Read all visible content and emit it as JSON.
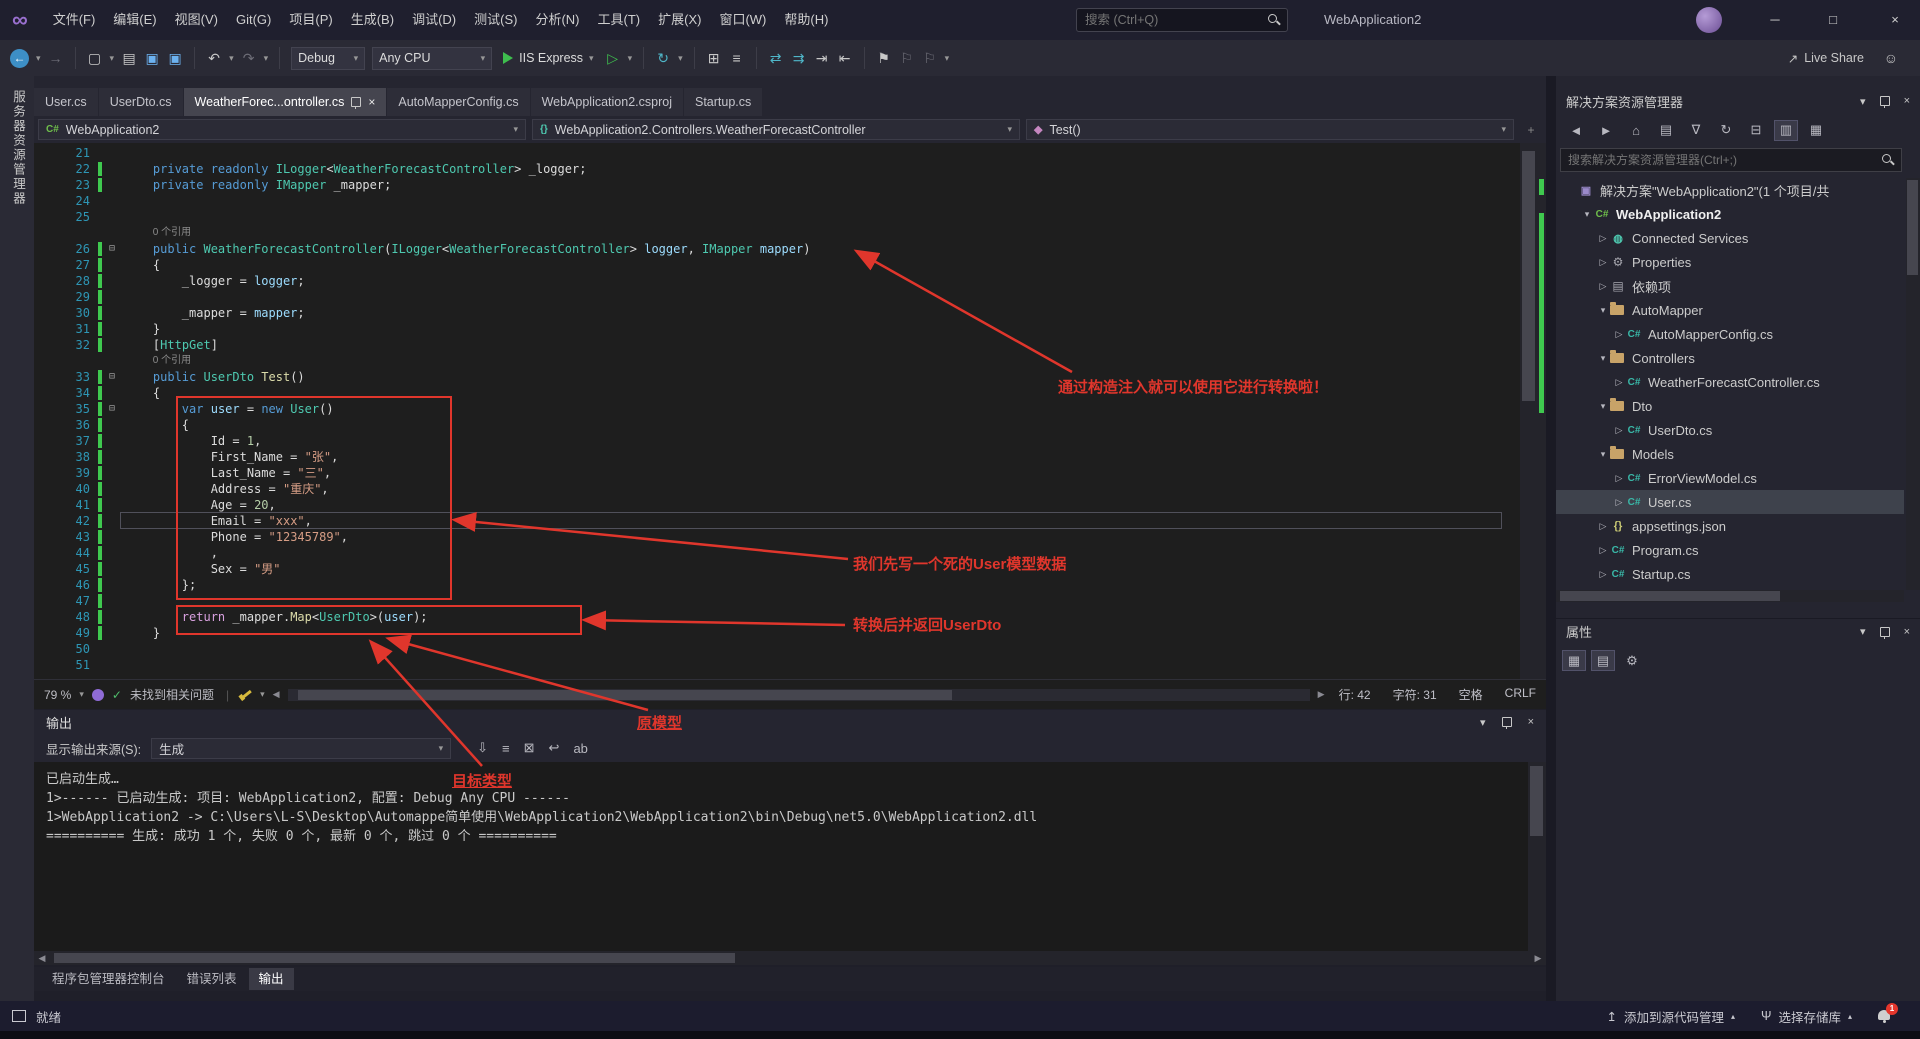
{
  "icons": {
    "chevron": "▾",
    "chevron_up": "▴",
    "close": "×",
    "minimize": "─",
    "maximize": "□",
    "back": "←",
    "forward": "→",
    "undo": "↶",
    "redo": "↷",
    "refresh": "↻",
    "flag": "⚑",
    "flag_outline": "⚐",
    "home": "⌂",
    "check": "✓",
    "gear": "⚙",
    "arrow_open": "▾",
    "arrow_closed": "▷",
    "cs_badge": "C#",
    "braces": "{}",
    "cube": "◆",
    "left_small": "◀",
    "right_small": "▶",
    "infinity": "∞",
    "person": "☺",
    "fold": "⊟",
    "solution": "▣",
    "services": "◍",
    "wrench": "⚙",
    "deps": "▤",
    "publish": "↥",
    "branch": "Ψ",
    "live_share": "↗"
  },
  "title_bar": {
    "menus": [
      "文件(F)",
      "编辑(E)",
      "视图(V)",
      "Git(G)",
      "项目(P)",
      "生成(B)",
      "调试(D)",
      "测试(S)",
      "分析(N)",
      "工具(T)",
      "扩展(X)",
      "窗口(W)",
      "帮助(H)"
    ],
    "search_placeholder": "搜索 (Ctrl+Q)",
    "app_title": "WebApplication2"
  },
  "toolbar": {
    "live_share_label": "Live Share",
    "items": [
      {
        "k": "icon",
        "name": "navigate-back-icon",
        "glyph": "←",
        "cls": "circ"
      },
      {
        "k": "chev",
        "name": "navigate-back-dropdown"
      },
      {
        "k": "icon",
        "name": "navigate-forward-icon",
        "glyph": "→",
        "cls": "dim"
      },
      {
        "k": "sep"
      },
      {
        "k": "icon",
        "name": "new-project-icon",
        "glyph": "▢"
      },
      {
        "k": "chev",
        "name": "new-project-dropdown"
      },
      {
        "k": "icon",
        "name": "open-file-icon",
        "glyph": "▤"
      },
      {
        "k": "icon",
        "name": "save-icon",
        "glyph": "▣",
        "cls": "blue"
      },
      {
        "k": "icon",
        "name": "save-all-icon",
        "glyph": "▣",
        "cls": "blue"
      },
      {
        "k": "sep"
      },
      {
        "k": "icon",
        "name": "undo-icon",
        "glyph": "↶"
      },
      {
        "k": "chev",
        "name": "undo-dropdown"
      },
      {
        "k": "icon",
        "name": "redo-icon",
        "glyph": "↷",
        "cls": "dim"
      },
      {
        "k": "chev",
        "name": "redo-dropdown"
      },
      {
        "k": "sep"
      },
      {
        "k": "combo",
        "name": "solution-configuration-combo",
        "label": "Debug",
        "w": 74
      },
      {
        "k": "combo",
        "name": "solution-platform-combo",
        "label": "Any CPU",
        "w": 120
      },
      {
        "k": "run",
        "name": "start-debugging-button",
        "label": "IIS Express"
      },
      {
        "k": "icon",
        "name": "start-without-debugging-icon",
        "glyph": "▷",
        "cls": "green"
      },
      {
        "k": "chev",
        "name": "run-target-dropdown"
      },
      {
        "k": "sep"
      },
      {
        "k": "icon",
        "name": "hot-reload-icon",
        "glyph": "↻",
        "cls": "teal"
      },
      {
        "k": "chev",
        "name": "hot-reload-dropdown"
      },
      {
        "k": "sep"
      },
      {
        "k": "icon",
        "name": "find-in-files-icon",
        "glyph": "⊞"
      },
      {
        "k": "icon",
        "name": "line-operations-icon",
        "glyph": "≡"
      },
      {
        "k": "sep"
      },
      {
        "k": "icon",
        "name": "show-directives-icon",
        "glyph": "⇄",
        "cls": "teal"
      },
      {
        "k": "icon",
        "name": "display-lines-icon",
        "glyph": "⇉",
        "cls": "teal"
      },
      {
        "k": "icon",
        "name": "indent-icon",
        "glyph": "⇥"
      },
      {
        "k": "icon",
        "name": "outdent-icon",
        "glyph": "⇤"
      },
      {
        "k": "sep"
      },
      {
        "k": "icon",
        "name": "bookmark-icon",
        "glyph": "⚑"
      },
      {
        "k": "icon",
        "name": "prev-bookmark-icon",
        "glyph": "⚐",
        "cls": "dim"
      },
      {
        "k": "icon",
        "name": "next-bookmark-icon",
        "glyph": "⚐",
        "cls": "dim"
      },
      {
        "k": "chev",
        "name": "bookmark-dropdown"
      }
    ]
  },
  "left_strip": {
    "label": "服务器资源管理器"
  },
  "tabs": [
    {
      "label": "User.cs",
      "active": false
    },
    {
      "label": "UserDto.cs",
      "active": false
    },
    {
      "label": "WeatherForec...ontroller.cs",
      "active": true
    },
    {
      "label": "AutoMapperConfig.cs",
      "active": false
    },
    {
      "label": "WebApplication2.csproj",
      "active": false
    },
    {
      "label": "Startup.cs",
      "active": false
    }
  ],
  "navbar": {
    "project": "WebApplication2",
    "type_name": "WebApplication2.Controllers.WeatherForecastController",
    "member": "Test()"
  },
  "editor": {
    "codelens_label": "0 个引用",
    "rows": [
      {
        "n": "21"
      },
      {
        "n": "22",
        "ind": 4,
        "g": 1,
        "tk": [
          {
            "t": "private readonly ",
            "c": "kw"
          },
          {
            "t": "ILogger",
            "c": "ty"
          },
          {
            "t": "<",
            "c": "pu"
          },
          {
            "t": "WeatherForecastController",
            "c": "ty"
          },
          {
            "t": "> ",
            "c": "pu"
          },
          {
            "t": "_logger",
            "c": "fd"
          },
          {
            "t": ";",
            "c": "pu"
          }
        ]
      },
      {
        "n": "23",
        "ind": 4,
        "g": 1,
        "tk": [
          {
            "t": "private readonly ",
            "c": "kw"
          },
          {
            "t": "IMapper",
            "c": "ty"
          },
          {
            "t": " _mapper",
            "c": "fd"
          },
          {
            "t": ";",
            "c": "pu"
          }
        ]
      },
      {
        "n": "24"
      },
      {
        "n": "25"
      },
      {
        "cl": true,
        "ind": 4
      },
      {
        "n": "26",
        "ind": 4,
        "g": 1,
        "f": 1,
        "tk": [
          {
            "t": "public ",
            "c": "kw"
          },
          {
            "t": "WeatherForecastController",
            "c": "ty"
          },
          {
            "t": "(",
            "c": "pu"
          },
          {
            "t": "ILogger",
            "c": "ty"
          },
          {
            "t": "<",
            "c": "pu"
          },
          {
            "t": "WeatherForecastController",
            "c": "ty"
          },
          {
            "t": "> ",
            "c": "pu"
          },
          {
            "t": "logger",
            "c": "pr"
          },
          {
            "t": ", ",
            "c": "pu"
          },
          {
            "t": "IMapper",
            "c": "ty"
          },
          {
            "t": " ",
            "c": "pu"
          },
          {
            "t": "mapper",
            "c": "pr"
          },
          {
            "t": ")",
            "c": "pu"
          }
        ]
      },
      {
        "n": "27",
        "ind": 4,
        "g": 1,
        "tk": [
          {
            "t": "{",
            "c": "pu"
          }
        ]
      },
      {
        "n": "28",
        "ind": 8,
        "g": 1,
        "tk": [
          {
            "t": "_logger",
            "c": "fd"
          },
          {
            "t": " = ",
            "c": "pu"
          },
          {
            "t": "logger",
            "c": "pr"
          },
          {
            "t": ";",
            "c": "pu"
          }
        ]
      },
      {
        "n": "29",
        "g": 1
      },
      {
        "n": "30",
        "ind": 8,
        "g": 1,
        "tk": [
          {
            "t": "_mapper",
            "c": "fd"
          },
          {
            "t": " = ",
            "c": "pu"
          },
          {
            "t": "mapper",
            "c": "pr"
          },
          {
            "t": ";",
            "c": "pu"
          }
        ]
      },
      {
        "n": "31",
        "ind": 4,
        "g": 1,
        "tk": [
          {
            "t": "}",
            "c": "pu"
          }
        ]
      },
      {
        "n": "32",
        "ind": 4,
        "g": 1,
        "tk": [
          {
            "t": "[",
            "c": "pu"
          },
          {
            "t": "HttpGet",
            "c": "ty"
          },
          {
            "t": "]",
            "c": "pu"
          }
        ]
      },
      {
        "cl": true,
        "ind": 4
      },
      {
        "n": "33",
        "ind": 4,
        "g": 1,
        "f": 1,
        "tk": [
          {
            "t": "public ",
            "c": "kw"
          },
          {
            "t": "UserDto",
            "c": "ty"
          },
          {
            "t": " ",
            "c": "pu"
          },
          {
            "t": "Test",
            "c": "mt"
          },
          {
            "t": "()",
            "c": "pu"
          }
        ]
      },
      {
        "n": "34",
        "ind": 4,
        "g": 1,
        "tk": [
          {
            "t": "{",
            "c": "pu"
          }
        ]
      },
      {
        "n": "35",
        "ind": 8,
        "g": 1,
        "f": 1,
        "tk": [
          {
            "t": "var",
            "c": "kw"
          },
          {
            "t": " ",
            "c": "pu"
          },
          {
            "t": "user",
            "c": "lc"
          },
          {
            "t": " = ",
            "c": "pu"
          },
          {
            "t": "new",
            "c": "kw"
          },
          {
            "t": " ",
            "c": "pu"
          },
          {
            "t": "User",
            "c": "ty"
          },
          {
            "t": "()",
            "c": "pu"
          }
        ]
      },
      {
        "n": "36",
        "ind": 8,
        "g": 1,
        "tk": [
          {
            "t": "{",
            "c": "pu"
          }
        ]
      },
      {
        "n": "37",
        "ind": 12,
        "g": 1,
        "tk": [
          {
            "t": "Id",
            "c": "pl"
          },
          {
            "t": " = ",
            "c": "pu"
          },
          {
            "t": "1",
            "c": "nm"
          },
          {
            "t": ",",
            "c": "pu"
          }
        ]
      },
      {
        "n": "38",
        "ind": 12,
        "g": 1,
        "tk": [
          {
            "t": "First_Name",
            "c": "pl"
          },
          {
            "t": " = ",
            "c": "pu"
          },
          {
            "t": "\"张\"",
            "c": "st"
          },
          {
            "t": ",",
            "c": "pu"
          }
        ]
      },
      {
        "n": "39",
        "ind": 12,
        "g": 1,
        "tk": [
          {
            "t": "Last_Name",
            "c": "pl"
          },
          {
            "t": " = ",
            "c": "pu"
          },
          {
            "t": "\"三\"",
            "c": "st"
          },
          {
            "t": ",",
            "c": "pu"
          }
        ]
      },
      {
        "n": "40",
        "ind": 12,
        "g": 1,
        "tk": [
          {
            "t": "Address",
            "c": "pl"
          },
          {
            "t": " = ",
            "c": "pu"
          },
          {
            "t": "\"重庆\"",
            "c": "st"
          },
          {
            "t": ",",
            "c": "pu"
          }
        ]
      },
      {
        "n": "41",
        "ind": 12,
        "g": 1,
        "tk": [
          {
            "t": "Age",
            "c": "pl"
          },
          {
            "t": " = ",
            "c": "pu"
          },
          {
            "t": "20",
            "c": "nm"
          },
          {
            "t": ",",
            "c": "pu"
          }
        ]
      },
      {
        "n": "42",
        "ind": 12,
        "g": 1,
        "cur": 1,
        "tk": [
          {
            "t": "Email",
            "c": "pl"
          },
          {
            "t": " = ",
            "c": "pu"
          },
          {
            "t": "\"xxx\"",
            "c": "st"
          },
          {
            "t": ",",
            "c": "pu"
          }
        ]
      },
      {
        "n": "43",
        "ind": 12,
        "g": 1,
        "tk": [
          {
            "t": "Phone",
            "c": "pl"
          },
          {
            "t": " = ",
            "c": "pu"
          },
          {
            "t": "\"12345789\"",
            "c": "st"
          },
          {
            "t": ",",
            "c": "pu"
          }
        ]
      },
      {
        "n": "44",
        "ind": 12,
        "g": 1,
        "tk": [
          {
            "t": ",",
            "c": "pu"
          }
        ]
      },
      {
        "n": "45",
        "ind": 12,
        "g": 1,
        "tk": [
          {
            "t": "Sex",
            "c": "pl"
          },
          {
            "t": " = ",
            "c": "pu"
          },
          {
            "t": "\"男\"",
            "c": "st"
          }
        ]
      },
      {
        "n": "46",
        "ind": 8,
        "g": 1,
        "tk": [
          {
            "t": "};",
            "c": "pu"
          }
        ]
      },
      {
        "n": "47",
        "g": 1
      },
      {
        "n": "48",
        "ind": 8,
        "g": 1,
        "tk": [
          {
            "t": "return",
            "c": "ct"
          },
          {
            "t": " ",
            "c": "pu"
          },
          {
            "t": "_mapper",
            "c": "fd"
          },
          {
            "t": ".",
            "c": "pu"
          },
          {
            "t": "Map",
            "c": "mt"
          },
          {
            "t": "<",
            "c": "pu"
          },
          {
            "t": "UserDto",
            "c": "ty"
          },
          {
            "t": ">(",
            "c": "pu"
          },
          {
            "t": "user",
            "c": "lc"
          },
          {
            "t": ");",
            "c": "pu"
          }
        ]
      },
      {
        "n": "49",
        "ind": 4,
        "g": 1,
        "tk": [
          {
            "t": "}",
            "c": "pu"
          }
        ]
      },
      {
        "n": "50"
      },
      {
        "n": "51"
      }
    ],
    "status": {
      "zoom": "79 %",
      "issues": "未找到相关问题",
      "line": "行: 42",
      "column": "字符: 31",
      "spaces": "空格",
      "line_ending": "CRLF"
    }
  },
  "annotations": {
    "constructor_note": "通过构造注入就可以使用它进行转换啦！",
    "model_note": "我们先写一个死的User模型数据",
    "return_note": "转换后并返回UserDto",
    "source_label": "原模型",
    "target_label": "目标类型"
  },
  "output": {
    "title": "输出",
    "source_label": "显示输出来源(S):",
    "source_value": "生成",
    "toolbar_icons": [
      {
        "name": "goto-message-icon",
        "glyph": "⇩"
      },
      {
        "name": "message-list-icon",
        "glyph": "≡"
      },
      {
        "name": "clear-all-icon",
        "glyph": "⊠"
      },
      {
        "name": "toggle-wrap-icon",
        "glyph": "↩"
      },
      {
        "name": "word-wrap-icon",
        "glyph": "ab"
      }
    ],
    "lines": [
      "已启动生成…",
      "1>------ 已启动生成: 项目: WebApplication2, 配置: Debug Any CPU ------",
      "1>WebApplication2 -> C:\\Users\\L-S\\Desktop\\Automappe简单使用\\WebApplication2\\WebApplication2\\bin\\Debug\\net5.0\\WebApplication2.dll",
      "========== 生成: 成功 1 个, 失败 0 个, 最新 0 个, 跳过 0 个 =========="
    ]
  },
  "bottom_tabs": {
    "items": [
      "程序包管理器控制台",
      "错误列表",
      "输出"
    ],
    "active_index": 2
  },
  "solution_explorer": {
    "title": "解决方案资源管理器",
    "search_placeholder": "搜索解决方案资源管理器(Ctrl+;)",
    "toolbar_icons": [
      {
        "name": "back-icon",
        "glyph": "◄"
      },
      {
        "name": "forward-icon",
        "glyph": "►"
      },
      {
        "name": "home-icon",
        "glyph": "⌂"
      },
      {
        "name": "switch-views-icon",
        "glyph": "▤"
      },
      {
        "name": "filter-icon",
        "glyph": "∇"
      },
      {
        "name": "sync-with-active-document-icon",
        "glyph": "↻"
      },
      {
        "name": "collapse-all-icon",
        "glyph": "⊟"
      },
      {
        "name": "preview-selected-icon",
        "glyph": "▥",
        "hl": true
      },
      {
        "name": "show-all-files-icon",
        "glyph": "▦"
      }
    ],
    "tree": [
      {
        "indent": 0,
        "arrow": "none",
        "icon": "solution",
        "label": "解决方案\"WebApplication2\"(1 个项目/共"
      },
      {
        "indent": 1,
        "arrow": "open",
        "icon": "csproj",
        "label": "WebApplication2",
        "bold": true
      },
      {
        "indent": 2,
        "arrow": "closed",
        "icon": "services",
        "label": "Connected Services"
      },
      {
        "indent": 2,
        "arrow": "closed",
        "icon": "properties",
        "label": "Properties"
      },
      {
        "indent": 2,
        "arrow": "closed",
        "icon": "deps",
        "label": "依赖项"
      },
      {
        "indent": 2,
        "arrow": "open",
        "icon": "folder",
        "label": "AutoMapper"
      },
      {
        "indent": 3,
        "arrow": "closed",
        "icon": "cs",
        "label": "AutoMapperConfig.cs"
      },
      {
        "indent": 2,
        "arrow": "open",
        "icon": "folder",
        "label": "Controllers"
      },
      {
        "indent": 3,
        "arrow": "closed",
        "icon": "cs",
        "label": "WeatherForecastController.cs"
      },
      {
        "indent": 2,
        "arrow": "open",
        "icon": "folder",
        "label": "Dto"
      },
      {
        "indent": 3,
        "arrow": "closed",
        "icon": "cs",
        "label": "UserDto.cs"
      },
      {
        "indent": 2,
        "arrow": "open",
        "icon": "folder",
        "label": "Models"
      },
      {
        "indent": 3,
        "arrow": "closed",
        "icon": "cs",
        "label": "ErrorViewModel.cs"
      },
      {
        "indent": 3,
        "arrow": "closed",
        "icon": "cs",
        "label": "User.cs",
        "selected": true
      },
      {
        "indent": 2,
        "arrow": "closed",
        "icon": "json",
        "label": "appsettings.json"
      },
      {
        "indent": 2,
        "arrow": "closed",
        "icon": "cs",
        "label": "Program.cs"
      },
      {
        "indent": 2,
        "arrow": "closed",
        "icon": "cs",
        "label": "Startup.cs"
      }
    ]
  },
  "properties_panel": {
    "title": "属性",
    "toolbar_icons": [
      {
        "name": "categorized-icon",
        "glyph": "▦",
        "hl": true
      },
      {
        "name": "alphabetical-icon",
        "glyph": "▤",
        "hl": true
      },
      {
        "name": "property-pages-icon",
        "glyph": "⚙"
      }
    ]
  },
  "status_bar": {
    "ready": "就绪",
    "add_to_source_control": "添加到源代码管理",
    "select_repository": "选择存储库",
    "notification_count": "1"
  }
}
